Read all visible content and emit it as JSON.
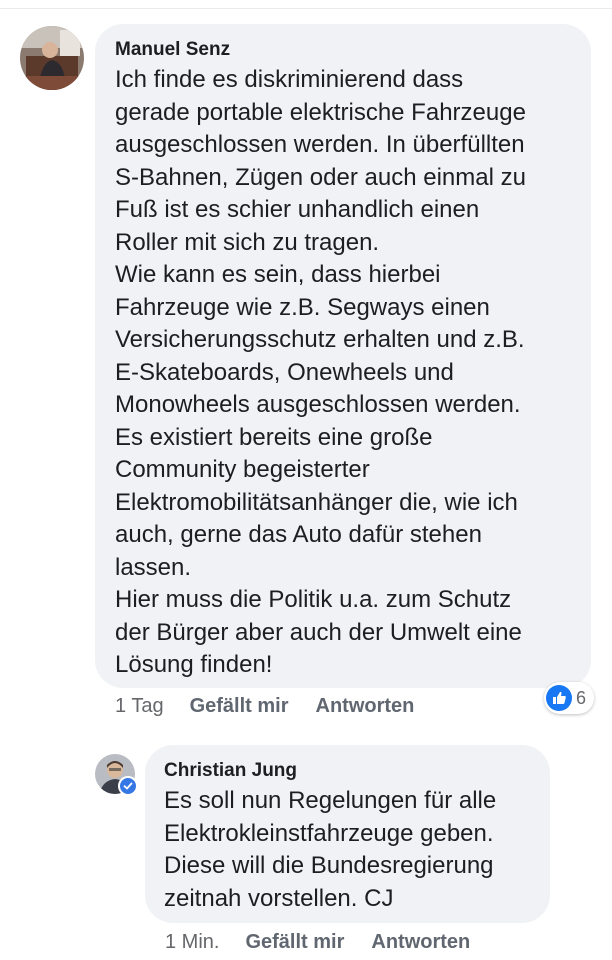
{
  "comments": [
    {
      "author": "Manuel Senz",
      "avatar_icon": "profile-photo",
      "text": "Ich finde es diskriminierend dass\ngerade portable elektrische Fahrzeuge\nausgeschlossen werden. In überfüllten\nS-Bahnen, Zügen oder auch einmal zu\nFuß ist es schier unhandlich einen\nRoller mit sich zu tragen.\nWie kann es sein, dass hierbei\nFahrzeuge wie z.B. Segways einen\nVersicherungsschutz erhalten und z.B.\nE-Skateboards, Onewheels und\nMonowheels ausgeschlossen werden.\nEs existiert bereits eine große\nCommunity begeisterter\nElektromobilitätsanhänger die, wie ich\nauch, gerne das Auto dafür stehen\nlassen.\nHier muss die Politik u.a. zum Schutz\nder Bürger aber auch der Umwelt eine\nLösung finden!",
      "time": "1 Tag",
      "like_label": "Gefällt mir",
      "reply_label": "Antworten",
      "reactions": {
        "icon": "thumbs-up-icon",
        "count": "6",
        "color": "#1877f2"
      }
    },
    {
      "author": "Christian Jung",
      "avatar_icon": "profile-photo",
      "badge_icon": "verified-badge-icon",
      "text": "Es soll nun Regelungen für alle\nElektrokleinstfahrzeuge geben.\nDiese will die Bundesregierung\nzeitnah vorstellen. CJ",
      "time": "1 Min.",
      "like_label": "Gefällt mir",
      "reply_label": "Antworten"
    }
  ],
  "colors": {
    "bubble_bg": "#f0f2f5",
    "text": "#1c1e21",
    "meta_text": "#65676b",
    "accent": "#1877f2"
  }
}
